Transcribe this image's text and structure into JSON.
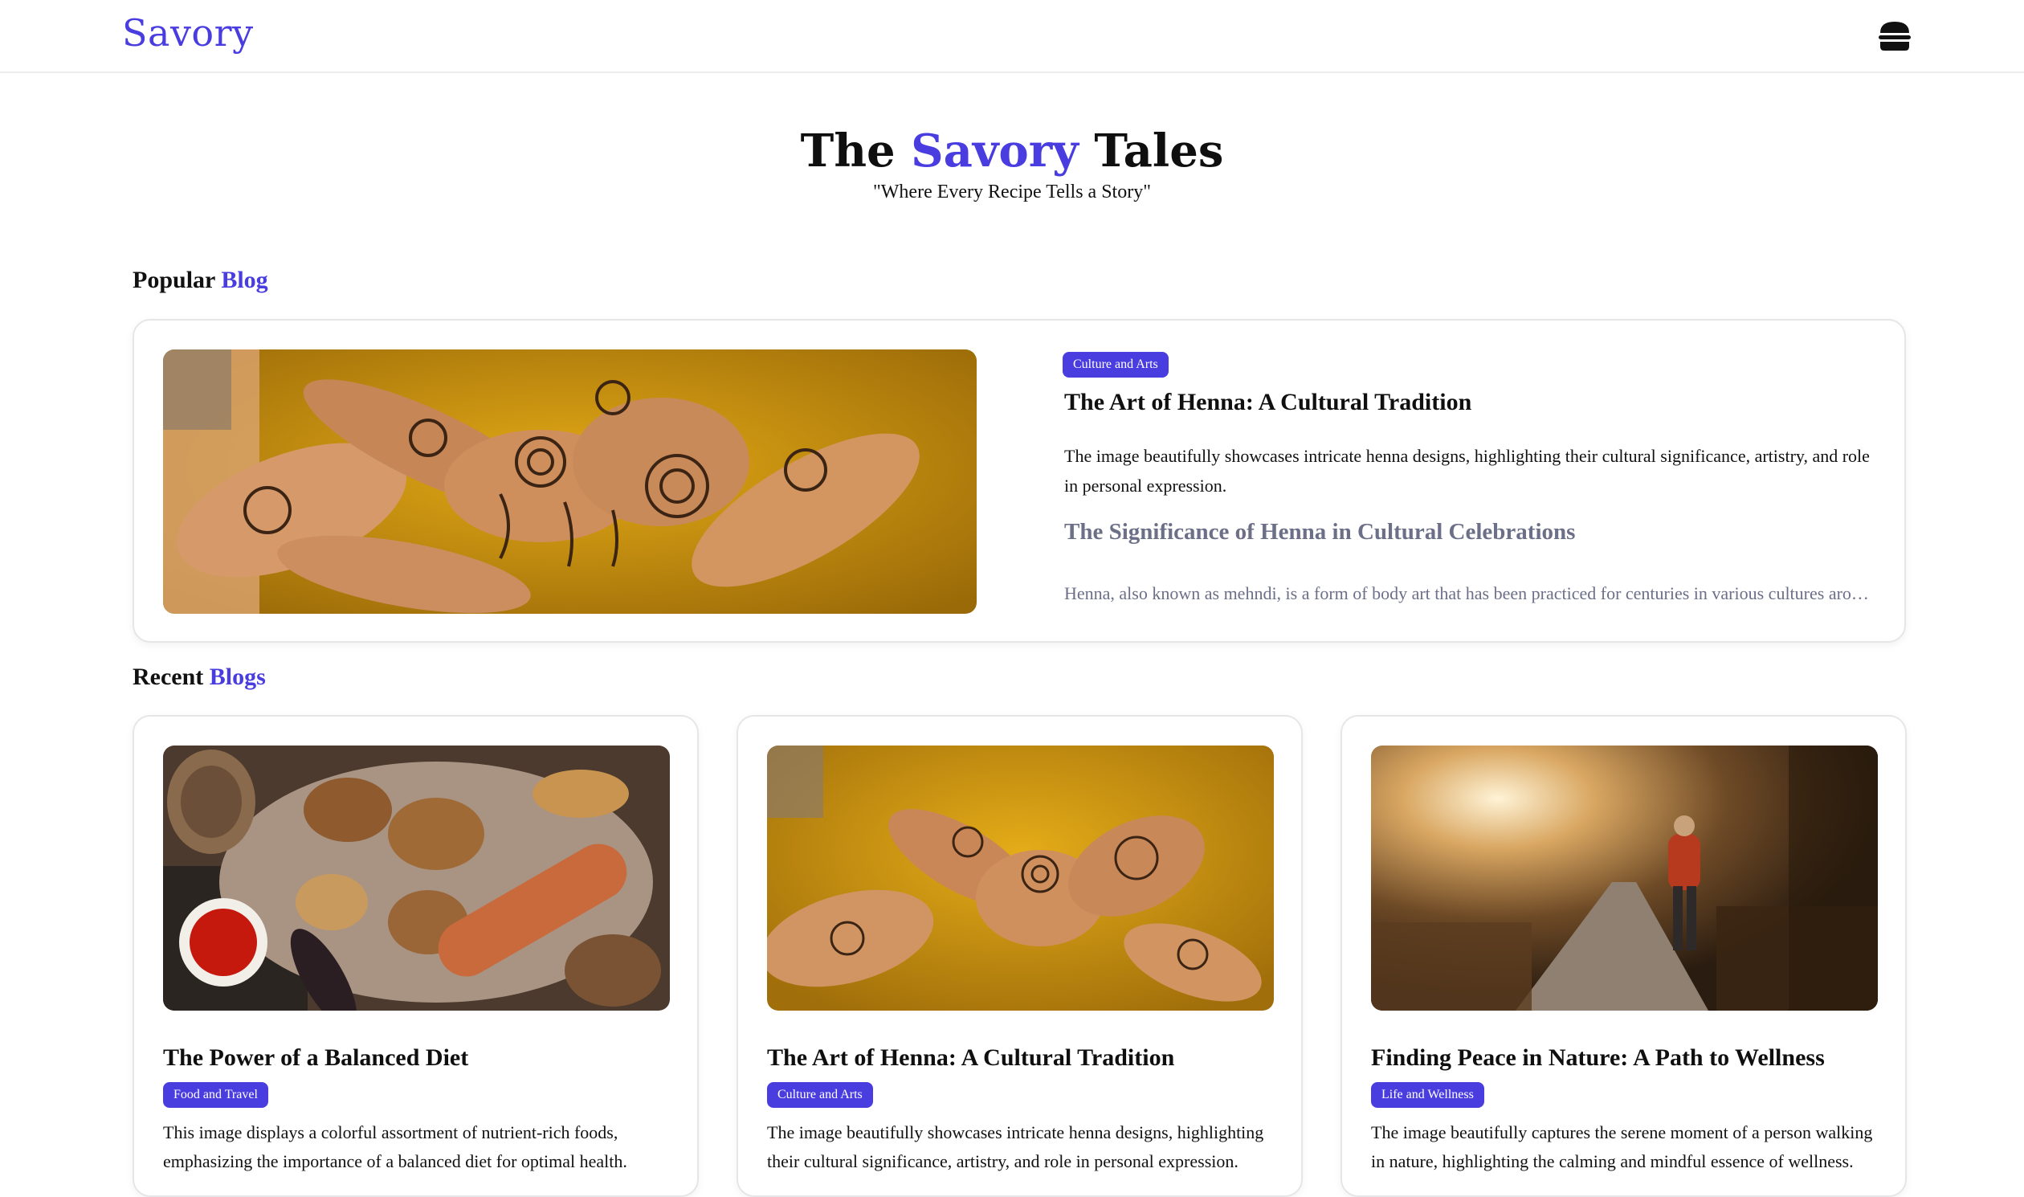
{
  "header": {
    "brand": "Savory",
    "menu_icon": "hamburger-icon"
  },
  "hero": {
    "title_prefix": "The ",
    "title_accent": "Savory",
    "title_suffix": " Tales",
    "tagline": "\"Where Every Recipe Tells a Story\""
  },
  "popular": {
    "heading_prefix": "Popular ",
    "heading_accent": "Blog",
    "post": {
      "tag": "Culture and Arts",
      "title": "The Art of Henna: A Cultural Tradition",
      "description": "The image beautifully showcases intricate henna designs, highlighting their cultural significance, artistry, and role in personal expression.",
      "subheading": "The Significance of Henna in Cultural Celebrations",
      "excerpt": "Henna, also known as mehndi, is a form of body art that has been practiced for centuries in various cultures around the world..."
    }
  },
  "recent": {
    "heading_prefix": "Recent ",
    "heading_accent": "Blogs",
    "posts": [
      {
        "title": "The Power of a Balanced Diet",
        "tag": "Food and Travel",
        "description": "This image displays a colorful assortment of nutrient-rich foods, emphasizing the importance of a balanced diet for optimal health."
      },
      {
        "title": "The Art of Henna: A Cultural Tradition",
        "tag": "Culture and Arts",
        "description": "The image beautifully showcases intricate henna designs, highlighting their cultural significance, artistry, and role in personal expression."
      },
      {
        "title": "Finding Peace in Nature: A Path to Wellness",
        "tag": "Life and Wellness",
        "description": "The image beautifully captures the serene moment of a person walking in nature, highlighting the calming and mindful essence of wellness."
      }
    ]
  },
  "colors": {
    "accent": "#4a3de0",
    "muted": "#6b6f87",
    "border": "#e6e6e8"
  }
}
